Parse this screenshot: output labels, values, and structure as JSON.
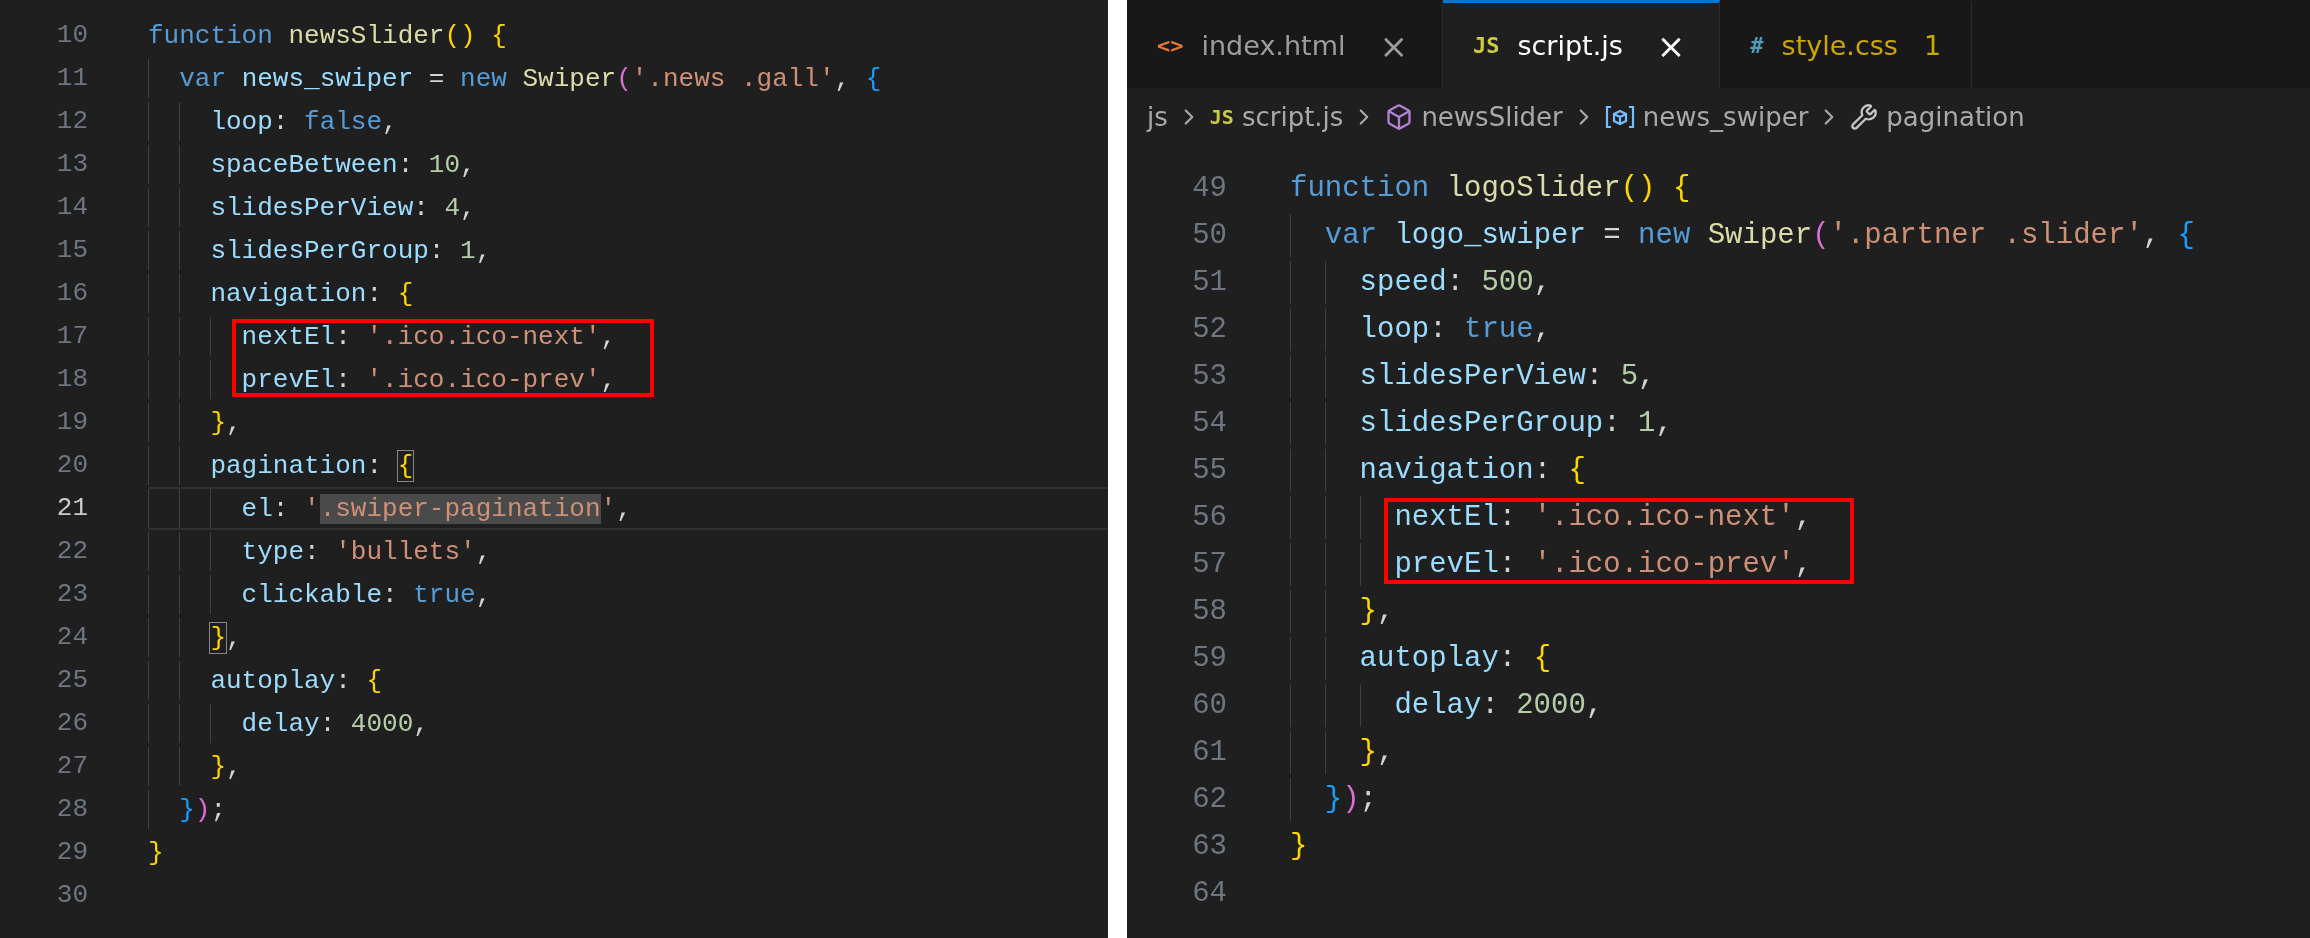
{
  "panels": [
    {
      "lines": [
        {
          "number": "10",
          "current": false,
          "boxed": false,
          "tokens": [
            {
              "kind": "keyword",
              "text": "function "
            },
            {
              "kind": "function",
              "text": "newsSlider"
            },
            {
              "kind": "bracket-1",
              "text": "() {"
            }
          ]
        },
        {
          "number": "11",
          "current": false,
          "boxed": false,
          "tokens": [
            {
              "kind": "keyword",
              "text": "  var "
            },
            {
              "kind": "variable",
              "text": "news_swiper"
            },
            {
              "kind": "punctuation",
              "text": " = "
            },
            {
              "kind": "keyword",
              "text": "new "
            },
            {
              "kind": "function",
              "text": "Swiper"
            },
            {
              "kind": "bracket-2",
              "text": "("
            },
            {
              "kind": "string",
              "text": "'.news .gall'"
            },
            {
              "kind": "punctuation",
              "text": ", "
            },
            {
              "kind": "bracket-3",
              "text": "{"
            }
          ]
        },
        {
          "number": "12",
          "current": false,
          "boxed": false,
          "tokens": [
            {
              "kind": "property",
              "text": "    loop"
            },
            {
              "kind": "punctuation",
              "text": ": "
            },
            {
              "kind": "keyword",
              "text": "false"
            },
            {
              "kind": "punctuation",
              "text": ","
            }
          ]
        },
        {
          "number": "13",
          "current": false,
          "boxed": false,
          "tokens": [
            {
              "kind": "property",
              "text": "    spaceBetween"
            },
            {
              "kind": "punctuation",
              "text": ": "
            },
            {
              "kind": "number",
              "text": "10"
            },
            {
              "kind": "punctuation",
              "text": ","
            }
          ]
        },
        {
          "number": "14",
          "current": false,
          "boxed": false,
          "tokens": [
            {
              "kind": "property",
              "text": "    slidesPerView"
            },
            {
              "kind": "punctuation",
              "text": ": "
            },
            {
              "kind": "number",
              "text": "4"
            },
            {
              "kind": "punctuation",
              "text": ","
            }
          ]
        },
        {
          "number": "15",
          "current": false,
          "boxed": false,
          "tokens": [
            {
              "kind": "property",
              "text": "    slidesPerGroup"
            },
            {
              "kind": "punctuation",
              "text": ": "
            },
            {
              "kind": "number",
              "text": "1"
            },
            {
              "kind": "punctuation",
              "text": ","
            }
          ]
        },
        {
          "number": "16",
          "current": false,
          "boxed": false,
          "tokens": [
            {
              "kind": "property",
              "text": "    navigation"
            },
            {
              "kind": "punctuation",
              "text": ": "
            },
            {
              "kind": "bracket-1",
              "text": "{"
            }
          ]
        },
        {
          "number": "17",
          "current": false,
          "boxed": true,
          "tokens": [
            {
              "kind": "property",
              "text": "      nextEl"
            },
            {
              "kind": "punctuation",
              "text": ": "
            },
            {
              "kind": "string",
              "text": "'.ico.ico-next'"
            },
            {
              "kind": "punctuation",
              "text": ","
            }
          ]
        },
        {
          "number": "18",
          "current": false,
          "boxed": true,
          "tokens": [
            {
              "kind": "property",
              "text": "      prevEl"
            },
            {
              "kind": "punctuation",
              "text": ": "
            },
            {
              "kind": "string",
              "text": "'.ico.ico-prev'"
            },
            {
              "kind": "punctuation",
              "text": ","
            }
          ]
        },
        {
          "number": "19",
          "current": false,
          "boxed": false,
          "tokens": [
            {
              "kind": "bracket-1",
              "text": "    }"
            },
            {
              "kind": "punctuation",
              "text": ","
            }
          ]
        },
        {
          "number": "20",
          "current": false,
          "boxed": false,
          "tokens": [
            {
              "kind": "property",
              "text": "    pagination"
            },
            {
              "kind": "punctuation",
              "text": ": "
            },
            {
              "kind": "bracket-1",
              "text": "{",
              "bracket_match": true
            }
          ]
        },
        {
          "number": "21",
          "current": true,
          "boxed": false,
          "tokens": [
            {
              "kind": "property",
              "text": "      el"
            },
            {
              "kind": "punctuation",
              "text": ": "
            },
            {
              "kind": "string",
              "text": "'"
            },
            {
              "kind": "string",
              "text": ".swiper-pagination",
              "selected": true
            },
            {
              "kind": "string",
              "text": "'"
            },
            {
              "kind": "punctuation",
              "text": ","
            }
          ]
        },
        {
          "number": "22",
          "current": false,
          "boxed": false,
          "tokens": [
            {
              "kind": "property",
              "text": "      type"
            },
            {
              "kind": "punctuation",
              "text": ": "
            },
            {
              "kind": "string",
              "text": "'bullets'"
            },
            {
              "kind": "punctuation",
              "text": ","
            }
          ]
        },
        {
          "number": "23",
          "current": false,
          "boxed": false,
          "tokens": [
            {
              "kind": "property",
              "text": "      clickable"
            },
            {
              "kind": "punctuation",
              "text": ": "
            },
            {
              "kind": "keyword",
              "text": "true"
            },
            {
              "kind": "punctuation",
              "text": ","
            }
          ]
        },
        {
          "number": "24",
          "current": false,
          "boxed": false,
          "tokens": [
            {
              "kind": "bracket-1",
              "text": "    }",
              "bracket_match": true
            },
            {
              "kind": "punctuation",
              "text": ","
            }
          ]
        },
        {
          "number": "25",
          "current": false,
          "boxed": false,
          "tokens": [
            {
              "kind": "property",
              "text": "    autoplay"
            },
            {
              "kind": "punctuation",
              "text": ": "
            },
            {
              "kind": "bracket-1",
              "text": "{"
            }
          ]
        },
        {
          "number": "26",
          "current": false,
          "boxed": false,
          "tokens": [
            {
              "kind": "property",
              "text": "      delay"
            },
            {
              "kind": "punctuation",
              "text": ": "
            },
            {
              "kind": "number",
              "text": "4000"
            },
            {
              "kind": "punctuation",
              "text": ","
            }
          ]
        },
        {
          "number": "27",
          "current": false,
          "boxed": false,
          "tokens": [
            {
              "kind": "bracket-1",
              "text": "    }"
            },
            {
              "kind": "punctuation",
              "text": ","
            }
          ]
        },
        {
          "number": "28",
          "current": false,
          "boxed": false,
          "tokens": [
            {
              "kind": "bracket-3",
              "text": "  }"
            },
            {
              "kind": "bracket-2",
              "text": ")"
            },
            {
              "kind": "punctuation",
              "text": ";"
            }
          ]
        },
        {
          "number": "29",
          "current": false,
          "boxed": false,
          "tokens": [
            {
              "kind": "bracket-1",
              "text": "}"
            }
          ]
        },
        {
          "number": "30",
          "current": false,
          "boxed": false
        }
      ]
    },
    {
      "tabs": [
        {
          "icon": "<>",
          "color": "#e37933",
          "label": "index.html",
          "close": "×",
          "selected": false,
          "warning": false
        },
        {
          "icon": "JS",
          "color": "#cbcb41",
          "label": "script.js",
          "close": "×",
          "selected": true,
          "warning": false
        },
        {
          "icon": "#",
          "color": "#519aba",
          "label": "style.css",
          "problems": "1",
          "selected": false,
          "warning": true
        }
      ],
      "breadcrumbs": [
        {
          "kind": "folder",
          "label": "js"
        },
        {
          "kind": "file",
          "icon": "JS",
          "label": "script.js"
        },
        {
          "kind": "function",
          "label": "newsSlider"
        },
        {
          "kind": "variable",
          "label": "news_swiper"
        },
        {
          "kind": "property",
          "label": "pagination"
        }
      ],
      "lines": [
        {
          "number": "49",
          "current": false,
          "boxed": false,
          "tokens": [
            {
              "kind": "keyword",
              "text": "function "
            },
            {
              "kind": "function",
              "text": "logoSlider"
            },
            {
              "kind": "bracket-1",
              "text": "() {"
            }
          ]
        },
        {
          "number": "50",
          "current": false,
          "boxed": false,
          "tokens": [
            {
              "kind": "keyword",
              "text": "  var "
            },
            {
              "kind": "variable",
              "text": "logo_swiper"
            },
            {
              "kind": "punctuation",
              "text": " = "
            },
            {
              "kind": "keyword",
              "text": "new "
            },
            {
              "kind": "function",
              "text": "Swiper"
            },
            {
              "kind": "bracket-2",
              "text": "("
            },
            {
              "kind": "string",
              "text": "'.partner .slider'"
            },
            {
              "kind": "punctuation",
              "text": ", "
            },
            {
              "kind": "bracket-3",
              "text": "{"
            }
          ]
        },
        {
          "number": "51",
          "current": false,
          "boxed": false,
          "tokens": [
            {
              "kind": "property",
              "text": "    speed"
            },
            {
              "kind": "punctuation",
              "text": ": "
            },
            {
              "kind": "number",
              "text": "500"
            },
            {
              "kind": "punctuation",
              "text": ","
            }
          ]
        },
        {
          "number": "52",
          "current": false,
          "boxed": false,
          "tokens": [
            {
              "kind": "property",
              "text": "    loop"
            },
            {
              "kind": "punctuation",
              "text": ": "
            },
            {
              "kind": "keyword",
              "text": "true"
            },
            {
              "kind": "punctuation",
              "text": ","
            }
          ]
        },
        {
          "number": "53",
          "current": false,
          "boxed": false,
          "tokens": [
            {
              "kind": "property",
              "text": "    slidesPerView"
            },
            {
              "kind": "punctuation",
              "text": ": "
            },
            {
              "kind": "number",
              "text": "5"
            },
            {
              "kind": "punctuation",
              "text": ","
            }
          ]
        },
        {
          "number": "54",
          "current": false,
          "boxed": false,
          "tokens": [
            {
              "kind": "property",
              "text": "    slidesPerGroup"
            },
            {
              "kind": "punctuation",
              "text": ": "
            },
            {
              "kind": "number",
              "text": "1"
            },
            {
              "kind": "punctuation",
              "text": ","
            }
          ]
        },
        {
          "number": "55",
          "current": false,
          "boxed": false,
          "tokens": [
            {
              "kind": "property",
              "text": "    navigation"
            },
            {
              "kind": "punctuation",
              "text": ": "
            },
            {
              "kind": "bracket-1",
              "text": "{"
            }
          ]
        },
        {
          "number": "56",
          "current": false,
          "boxed": true,
          "tokens": [
            {
              "kind": "property",
              "text": "      nextEl"
            },
            {
              "kind": "punctuation",
              "text": ": "
            },
            {
              "kind": "string",
              "text": "'.ico.ico-next'"
            },
            {
              "kind": "punctuation",
              "text": ","
            }
          ]
        },
        {
          "number": "57",
          "current": false,
          "boxed": true,
          "tokens": [
            {
              "kind": "property",
              "text": "      prevEl"
            },
            {
              "kind": "punctuation",
              "text": ": "
            },
            {
              "kind": "string",
              "text": "'.ico.ico-prev'"
            },
            {
              "kind": "punctuation",
              "text": ","
            }
          ]
        },
        {
          "number": "58",
          "current": false,
          "boxed": false,
          "tokens": [
            {
              "kind": "bracket-1",
              "text": "    }"
            },
            {
              "kind": "punctuation",
              "text": ","
            }
          ]
        },
        {
          "number": "59",
          "current": false,
          "boxed": false,
          "tokens": [
            {
              "kind": "property",
              "text": "    autoplay"
            },
            {
              "kind": "punctuation",
              "text": ": "
            },
            {
              "kind": "bracket-1",
              "text": "{"
            }
          ]
        },
        {
          "number": "60",
          "current": false,
          "boxed": false,
          "tokens": [
            {
              "kind": "property",
              "text": "      delay"
            },
            {
              "kind": "punctuation",
              "text": ": "
            },
            {
              "kind": "number",
              "text": "2000"
            },
            {
              "kind": "punctuation",
              "text": ","
            }
          ]
        },
        {
          "number": "61",
          "current": false,
          "boxed": false,
          "tokens": [
            {
              "kind": "bracket-1",
              "text": "    }"
            },
            {
              "kind": "punctuation",
              "text": ","
            }
          ]
        },
        {
          "number": "62",
          "current": false,
          "boxed": false,
          "tokens": [
            {
              "kind": "bracket-3",
              "text": "  }"
            },
            {
              "kind": "bracket-2",
              "text": ")"
            },
            {
              "kind": "punctuation",
              "text": ";"
            }
          ]
        },
        {
          "number": "63",
          "current": false,
          "boxed": false,
          "tokens": [
            {
              "kind": "bracket-1",
              "text": "}"
            }
          ]
        },
        {
          "number": "64",
          "current": false,
          "boxed": false
        }
      ]
    }
  ]
}
